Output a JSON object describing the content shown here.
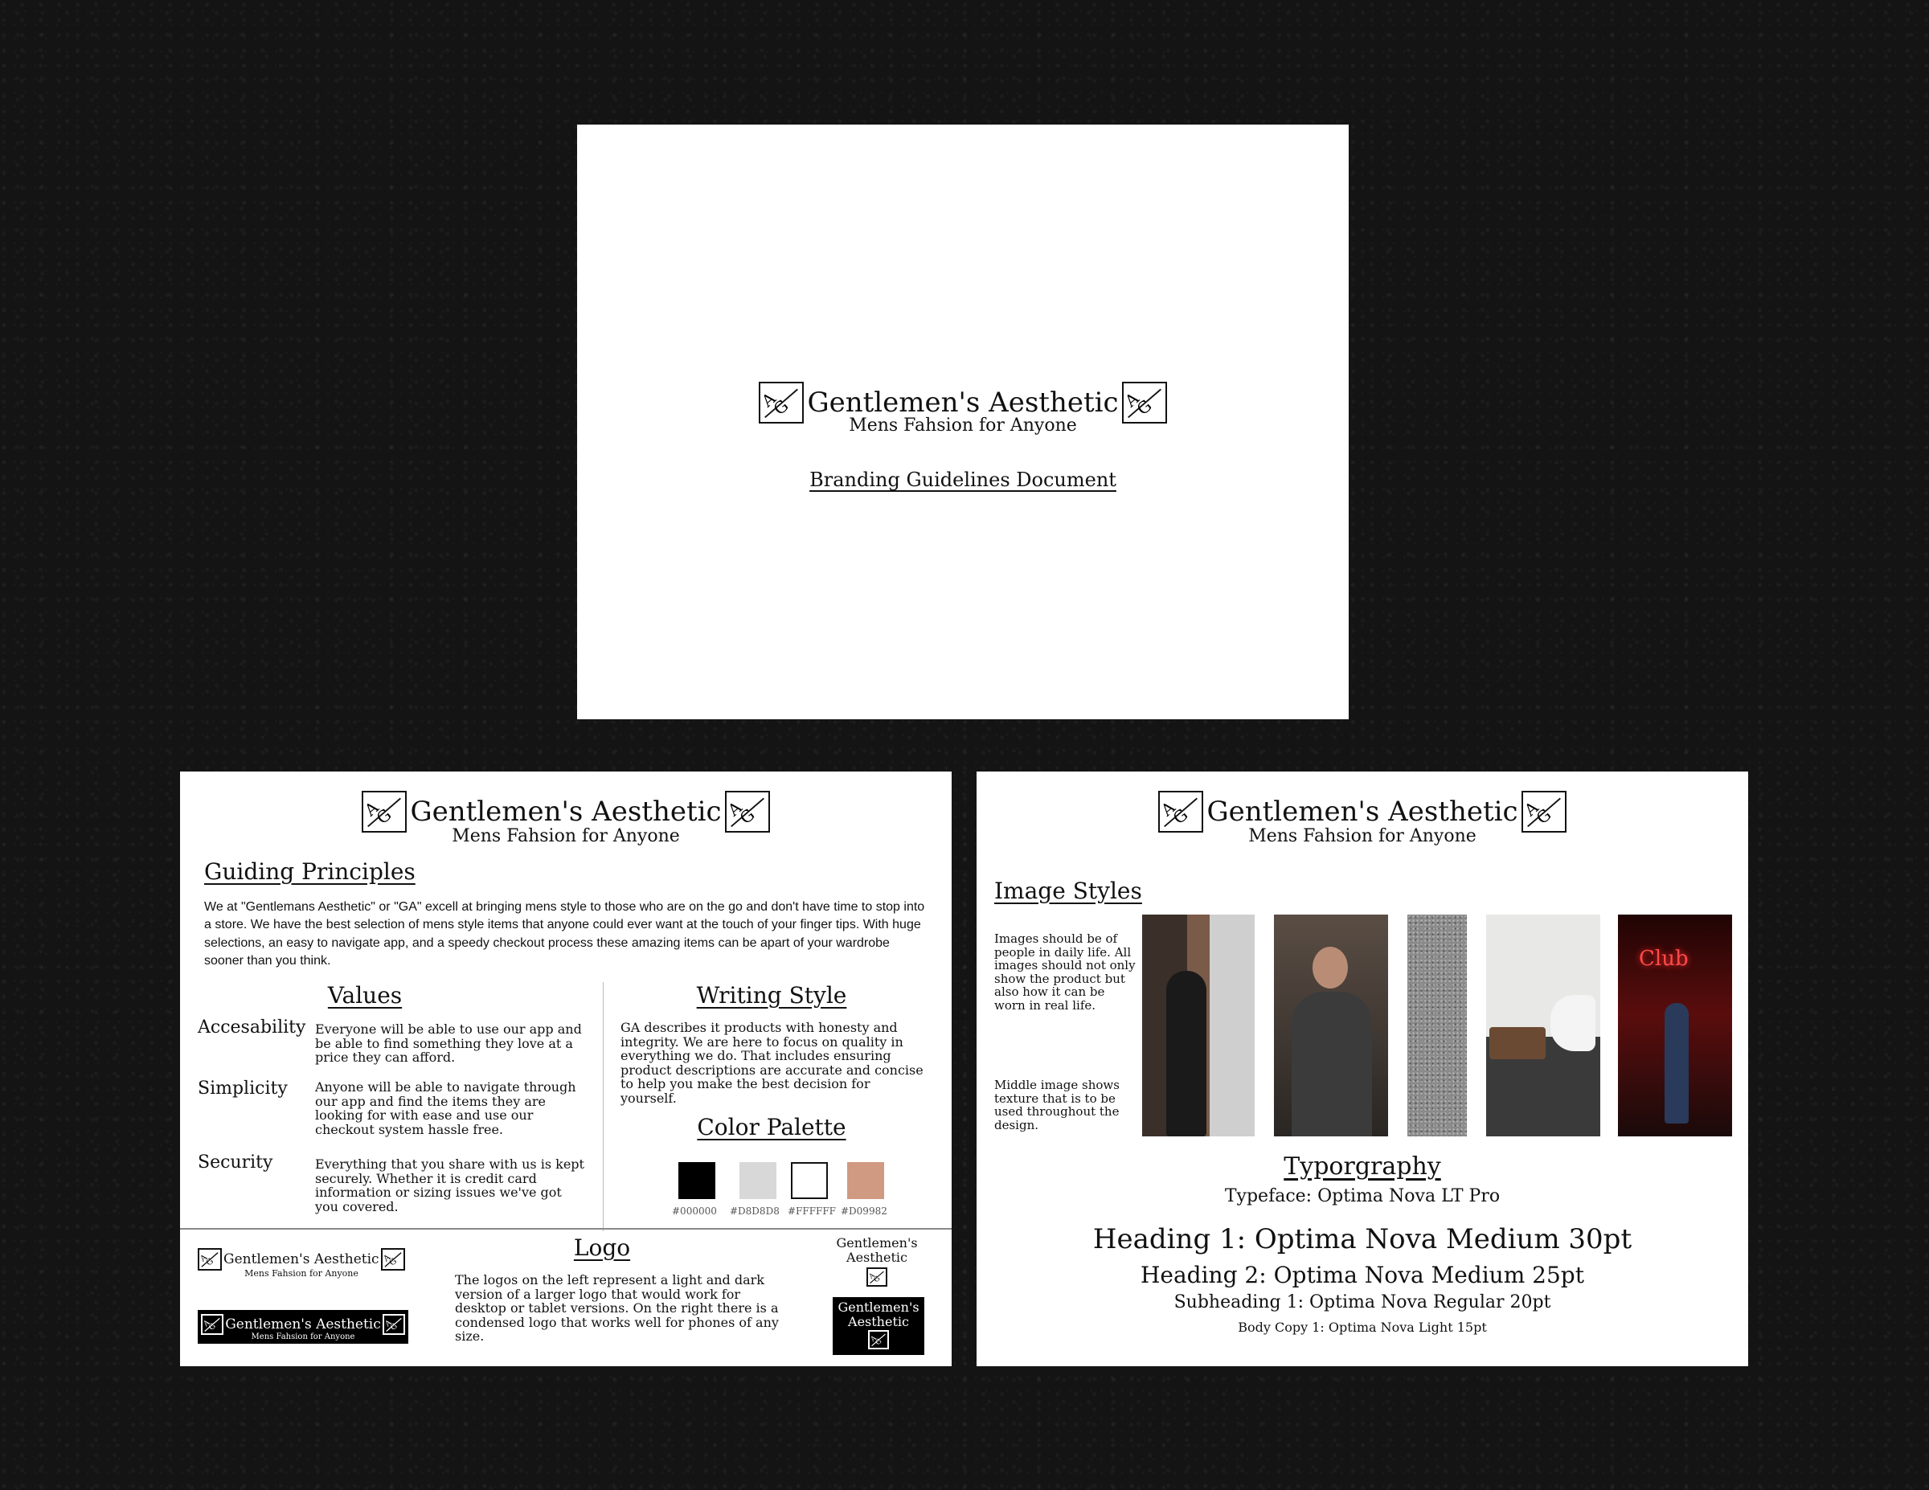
{
  "cover": {
    "brand": "Gentlemen's Aesthetic",
    "tagline": "Mens Fahsion for Anyone",
    "doc_title": "Branding Guidelines Document"
  },
  "principles_card": {
    "brand": "Gentlemen's Aesthetic",
    "tagline": "Mens Fahsion for Anyone",
    "guiding_heading": "Guiding Principles",
    "guiding_text": "We at \"Gentlemans Aesthetic\" or \"GA\" excell at bringing mens style to those who are on the go and don't have time to stop into a store.  We have the best selection of mens style items that anyone could ever want at the touch of your finger tips. With huge selections, an easy to navigate app, and a speedy checkout process these amazing items can be apart of your wardrobe sooner than you think.",
    "values_heading": "Values",
    "values": [
      {
        "name": "Accesability",
        "text": "Everyone will be able to use our app and be able to find something they love at a price they can afford."
      },
      {
        "name": "Simplicity",
        "text": "Anyone will be able to navigate through our app and find the items they are looking for with ease and use our checkout system hassle free."
      },
      {
        "name": "Security",
        "text": "Everything that you share with us is kept securely. Whether it is credit card information or sizing issues we've got you covered."
      }
    ],
    "writing_heading": "Writing Style",
    "writing_text": "GA describes it products with honesty and integrity. We are here to focus on quality in everything we do. That includes ensuring product descriptions are accurate and concise to help you make the best decision for yourself.",
    "palette_heading": "Color Palette",
    "palette": [
      {
        "hex": "#000000",
        "label": "#000000"
      },
      {
        "hex": "#D8D8D8",
        "label": "#D8D8D8"
      },
      {
        "hex": "#FFFFFF",
        "label": "#FFFFFF"
      },
      {
        "hex": "#D09982",
        "label": "#D09982"
      }
    ],
    "logo_heading": "Logo",
    "logo_text": "The logos on the left represent a light and dark version of a larger logo that would work for desktop or tablet versions. On the right there is a condensed logo that works well for phones of any size.",
    "small_logo_brand": "Gentlemen's Aesthetic",
    "small_logo_tagline": "Mens Fahsion for Anyone",
    "condensed_line1": "Gentlemen's",
    "condensed_line2": "Aesthetic"
  },
  "styles_card": {
    "brand": "Gentlemen's Aesthetic",
    "tagline": "Mens Fahsion for Anyone",
    "image_heading": "Image Styles",
    "image_text_1": "Images should be of people in daily life. All images should not only show the product but also how it can be worn in real life.",
    "image_text_2": "Middle image shows texture that is to be used throughout the design.",
    "photo_sign": "Club",
    "typography_heading": "Typorgraphy",
    "typeface": "Typeface: Optima Nova LT Pro",
    "heading1": "Heading 1: Optima Nova Medium 30pt",
    "heading2": "Heading 2: Optima Nova Medium 25pt",
    "subheading1": "Subheading 1: Optima Nova Regular 20pt",
    "body1": "Body Copy 1: Optima Nova Light 15pt"
  }
}
